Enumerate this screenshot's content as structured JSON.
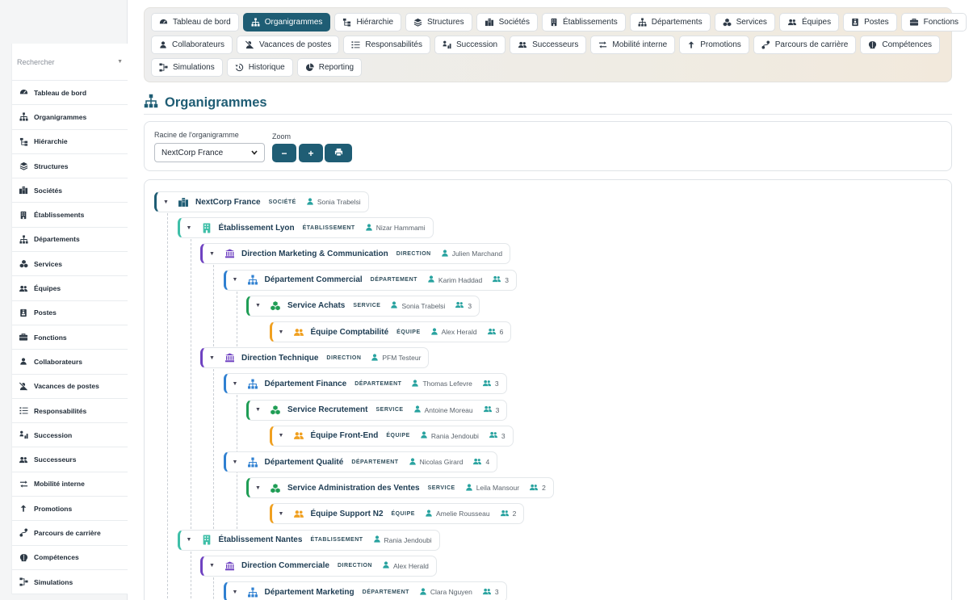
{
  "sidebar": {
    "search_placeholder": "Rechercher",
    "items": [
      {
        "label": "Tableau de bord",
        "icon": "gauge-icon"
      },
      {
        "label": "Organigrammes",
        "icon": "sitemap-icon"
      },
      {
        "label": "Hiérarchie",
        "icon": "hierarchy-icon"
      },
      {
        "label": "Structures",
        "icon": "layers-icon"
      },
      {
        "label": "Sociétés",
        "icon": "building-icon"
      },
      {
        "label": "Établissements",
        "icon": "office-icon"
      },
      {
        "label": "Départements",
        "icon": "sitemap-icon"
      },
      {
        "label": "Services",
        "icon": "cubes-icon"
      },
      {
        "label": "Équipes",
        "icon": "users-icon"
      },
      {
        "label": "Postes",
        "icon": "id-badge-icon"
      },
      {
        "label": "Fonctions",
        "icon": "briefcase-icon"
      },
      {
        "label": "Collaborateurs",
        "icon": "user-icon"
      },
      {
        "label": "Vacances de postes",
        "icon": "user-slash-icon"
      },
      {
        "label": "Responsabilités",
        "icon": "list-icon"
      },
      {
        "label": "Succession",
        "icon": "succession-icon"
      },
      {
        "label": "Successeurs",
        "icon": "users-icon"
      },
      {
        "label": "Mobilité interne",
        "icon": "exchange-icon"
      },
      {
        "label": "Promotions",
        "icon": "arrow-up-icon"
      },
      {
        "label": "Parcours de carrière",
        "icon": "route-icon"
      },
      {
        "label": "Compétences",
        "icon": "brain-icon"
      },
      {
        "label": "Simulations",
        "icon": "diagram-icon"
      }
    ]
  },
  "topnav": {
    "rows": [
      [
        {
          "label": "Tableau de bord",
          "icon": "gauge-icon",
          "active": false
        },
        {
          "label": "Organigrammes",
          "icon": "sitemap-icon",
          "active": true
        },
        {
          "label": "Hiérarchie",
          "icon": "hierarchy-icon",
          "active": false
        },
        {
          "label": "Structures",
          "icon": "layers-icon",
          "active": false
        },
        {
          "label": "Sociétés",
          "icon": "building-icon",
          "active": false
        },
        {
          "label": "Établissements",
          "icon": "office-icon",
          "active": false
        },
        {
          "label": "Départements",
          "icon": "sitemap-icon",
          "active": false
        },
        {
          "label": "Services",
          "icon": "cubes-icon",
          "active": false
        },
        {
          "label": "Équipes",
          "icon": "users-icon",
          "active": false
        },
        {
          "label": "Postes",
          "icon": "id-badge-icon",
          "active": false
        },
        {
          "label": "Fonctions",
          "icon": "briefcase-icon",
          "active": false
        }
      ],
      [
        {
          "label": "Collaborateurs",
          "icon": "user-icon",
          "active": false
        },
        {
          "label": "Vacances de postes",
          "icon": "user-slash-icon",
          "active": false
        },
        {
          "label": "Responsabilités",
          "icon": "list-icon",
          "active": false
        },
        {
          "label": "Succession",
          "icon": "succession-icon",
          "active": false
        },
        {
          "label": "Successeurs",
          "icon": "users-icon",
          "active": false
        },
        {
          "label": "Mobilité interne",
          "icon": "exchange-icon",
          "active": false
        },
        {
          "label": "Promotions",
          "icon": "arrow-up-icon",
          "active": false
        },
        {
          "label": "Parcours de carrière",
          "icon": "route-icon",
          "active": false
        },
        {
          "label": "Compétences",
          "icon": "brain-icon",
          "active": false
        }
      ],
      [
        {
          "label": "Simulations",
          "icon": "diagram-icon",
          "active": false
        },
        {
          "label": "Historique",
          "icon": "history-icon",
          "active": false
        },
        {
          "label": "Reporting",
          "icon": "pie-chart-icon",
          "active": false
        }
      ]
    ]
  },
  "page": {
    "title": "Organigrammes",
    "title_icon": "sitemap-icon"
  },
  "controls": {
    "root_label": "Racine de l'organigramme",
    "root_value": "NextCorp France",
    "zoom_label": "Zoom",
    "zoom_out": "−",
    "zoom_in": "+",
    "print_icon": "print-icon"
  },
  "colors": {
    "accent": "#1f5d74",
    "societe": "#1f5d74",
    "etablissement": "#3fbfa8",
    "direction": "#6f42c1",
    "departement": "#2f80d1",
    "service": "#1f9d55",
    "equipe": "#f0a020"
  },
  "tree": [
    {
      "name": "NextCorp France",
      "type": "SOCIÉTÉ",
      "kind": "societe",
      "manager": "Sonia Trabelsi",
      "count": null,
      "level": 0
    },
    {
      "name": "Établissement Lyon",
      "type": "ÉTABLISSEMENT",
      "kind": "etablissement",
      "manager": "Nizar Hammami",
      "count": null,
      "level": 1
    },
    {
      "name": "Direction Marketing & Communication",
      "type": "DIRECTION",
      "kind": "direction",
      "manager": "Julien Marchand",
      "count": null,
      "level": 2
    },
    {
      "name": "Département Commercial",
      "type": "DÉPARTEMENT",
      "kind": "departement",
      "manager": "Karim Haddad",
      "count": "3",
      "level": 3
    },
    {
      "name": "Service Achats",
      "type": "SERVICE",
      "kind": "service",
      "manager": "Sonia Trabelsi",
      "count": "3",
      "level": 4
    },
    {
      "name": "Équipe Comptabilité",
      "type": "ÉQUIPE",
      "kind": "equipe",
      "manager": "Alex Herald",
      "count": "6",
      "level": 5
    },
    {
      "name": "Direction Technique",
      "type": "DIRECTION",
      "kind": "direction",
      "manager": "PFM Testeur",
      "count": null,
      "level": 2
    },
    {
      "name": "Département Finance",
      "type": "DÉPARTEMENT",
      "kind": "departement",
      "manager": "Thomas Lefevre",
      "count": "3",
      "level": 3
    },
    {
      "name": "Service Recrutement",
      "type": "SERVICE",
      "kind": "service",
      "manager": "Antoine Moreau",
      "count": "3",
      "level": 4
    },
    {
      "name": "Équipe Front-End",
      "type": "ÉQUIPE",
      "kind": "equipe",
      "manager": "Rania Jendoubi",
      "count": "3",
      "level": 5
    },
    {
      "name": "Département Qualité",
      "type": "DÉPARTEMENT",
      "kind": "departement",
      "manager": "Nicolas Girard",
      "count": "4",
      "level": 3
    },
    {
      "name": "Service Administration des Ventes",
      "type": "SERVICE",
      "kind": "service",
      "manager": "Leila Mansour",
      "count": "2",
      "level": 4
    },
    {
      "name": "Équipe Support N2",
      "type": "ÉQUIPE",
      "kind": "equipe",
      "manager": "Amelie Rousseau",
      "count": "2",
      "level": 5
    },
    {
      "name": "Établissement Nantes",
      "type": "ÉTABLISSEMENT",
      "kind": "etablissement",
      "manager": "Rania Jendoubi",
      "count": null,
      "level": 1
    },
    {
      "name": "Direction Commerciale",
      "type": "DIRECTION",
      "kind": "direction",
      "manager": "Alex Herald",
      "count": null,
      "level": 2
    },
    {
      "name": "Département Marketing",
      "type": "DÉPARTEMENT",
      "kind": "departement",
      "manager": "Clara Nguyen",
      "count": "3",
      "level": 3
    }
  ]
}
